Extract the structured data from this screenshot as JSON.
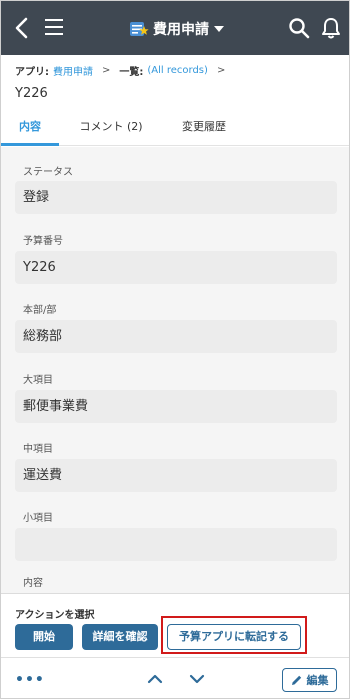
{
  "header": {
    "title": "費用申請",
    "icons": {
      "back": "back-chevron-icon",
      "menu": "hamburger-menu-icon",
      "search": "search-icon",
      "notifications": "bell-icon",
      "app": "app-icon"
    }
  },
  "breadcrumb": {
    "app_label": "アプリ:",
    "app_link": "費用申請",
    "list_label": "一覧:",
    "list_link": "(All records)"
  },
  "record": {
    "id": "Y226"
  },
  "tabs": [
    {
      "label": "内容",
      "active": true
    },
    {
      "label": "コメント (2)",
      "active": false
    },
    {
      "label": "変更履歴",
      "active": false
    }
  ],
  "fields": [
    {
      "label": "ステータス",
      "value": "登録"
    },
    {
      "label": "予算番号",
      "value": "Y226"
    },
    {
      "label": "本部/部",
      "value": "総務部"
    },
    {
      "label": "大項目",
      "value": "郵便事業費"
    },
    {
      "label": "中項目",
      "value": "運送費"
    },
    {
      "label": "小項目",
      "value": ""
    },
    {
      "label": "内容",
      "value": ""
    }
  ],
  "actions": {
    "heading": "アクションを選択",
    "buttons": [
      {
        "label": "開始",
        "style": "filled"
      },
      {
        "label": "詳細を確認",
        "style": "filled"
      },
      {
        "label": "予算アプリに転記する",
        "style": "outline",
        "highlighted": true
      }
    ]
  },
  "bottom": {
    "more_label": "•••",
    "edit_label": "編集"
  },
  "colors": {
    "header_bg": "#3f4852",
    "accent": "#3498db",
    "button": "#2e6b99",
    "highlight": "#d11a1a"
  }
}
